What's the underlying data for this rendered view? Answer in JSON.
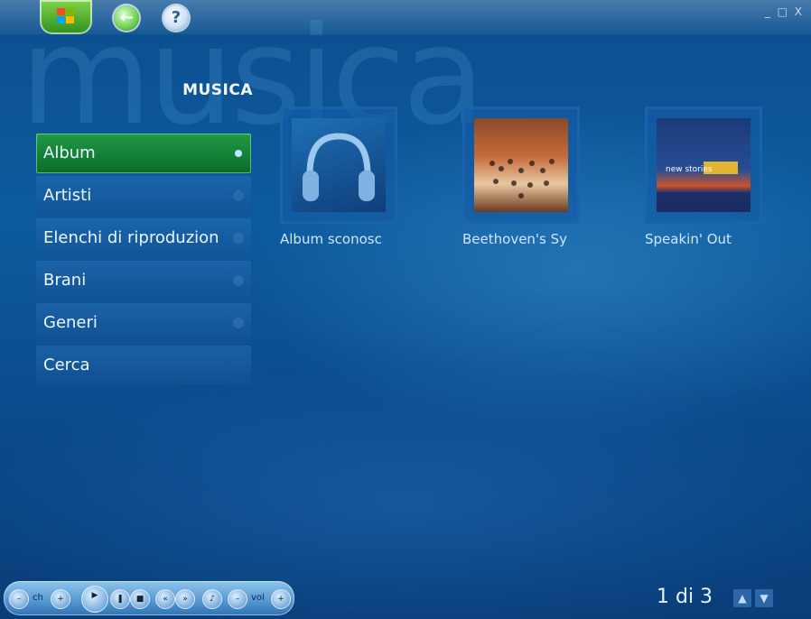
{
  "window": {
    "controls": "_ □ X"
  },
  "header": {
    "watermark": "musica",
    "title": "MUSICA"
  },
  "menu": {
    "items": [
      {
        "label": "Album",
        "active": true
      },
      {
        "label": "Artisti",
        "active": false
      },
      {
        "label": "Elenchi di riproduzion",
        "active": false
      },
      {
        "label": "Brani",
        "active": false
      },
      {
        "label": "Generi",
        "active": false
      },
      {
        "label": "Cerca",
        "active": false
      }
    ]
  },
  "albums": [
    {
      "label": "Album sconosc",
      "icon": "headphones-icon"
    },
    {
      "label": "Beethoven's Sy",
      "icon": "orchestra-cover"
    },
    {
      "label": "Speakin' Out",
      "icon": "band-cover",
      "cover_text": "new stories"
    }
  ],
  "transport": {
    "ch_label": "ch",
    "vol_label": "vol"
  },
  "pager": {
    "text": "1 di 3"
  },
  "colors": {
    "background": "#0c5a9e",
    "active_item": "#1f9a46",
    "text": "#eef6ff"
  }
}
